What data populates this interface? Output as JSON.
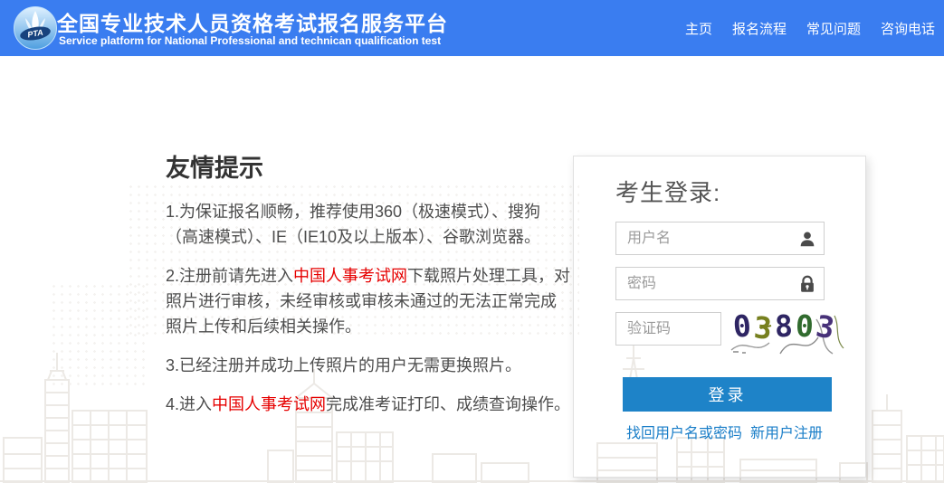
{
  "header": {
    "title": "全国专业技术人员资格考试报名服务平台",
    "subtitle": "Service platform for National Professional and technican qualification test",
    "logo_text": "PTA",
    "bg_color": "#3A7DF0",
    "nav": [
      {
        "label": "主页"
      },
      {
        "label": "报名流程"
      },
      {
        "label": "常见问题"
      },
      {
        "label": "咨询电话"
      }
    ]
  },
  "tips": {
    "heading": "友情提示",
    "p1": "1.为保证报名顺畅，推荐使用360（极速模式）、搜狗（高速模式）、IE（IE10及以上版本）、谷歌浏览器。",
    "p2_prefix": "2.注册前请先进入",
    "p2_link": "中国人事考试网",
    "p2_suffix": "下载照片处理工具，对照片进行审核，未经审核或审核未通过的无法正常完成照片上传和后续相关操作。",
    "p3": "3.已经注册并成功上传照片的用户无需更换照片。",
    "p4_prefix": "4.进入",
    "p4_link": "中国人事考试网",
    "p4_suffix": "完成准考证打印、成绩查询操作。",
    "highlight_color": "#E60000"
  },
  "login": {
    "heading": "考生登录:",
    "username_placeholder": "用户名",
    "password_placeholder": "密码",
    "captcha_placeholder": "验证码",
    "captcha_value": "03803",
    "login_button": "登录",
    "forgot_link": "找回用户名或密码",
    "register_link": "新用户注册",
    "button_color": "#1E83C8",
    "link_color": "#1A7EC8"
  }
}
